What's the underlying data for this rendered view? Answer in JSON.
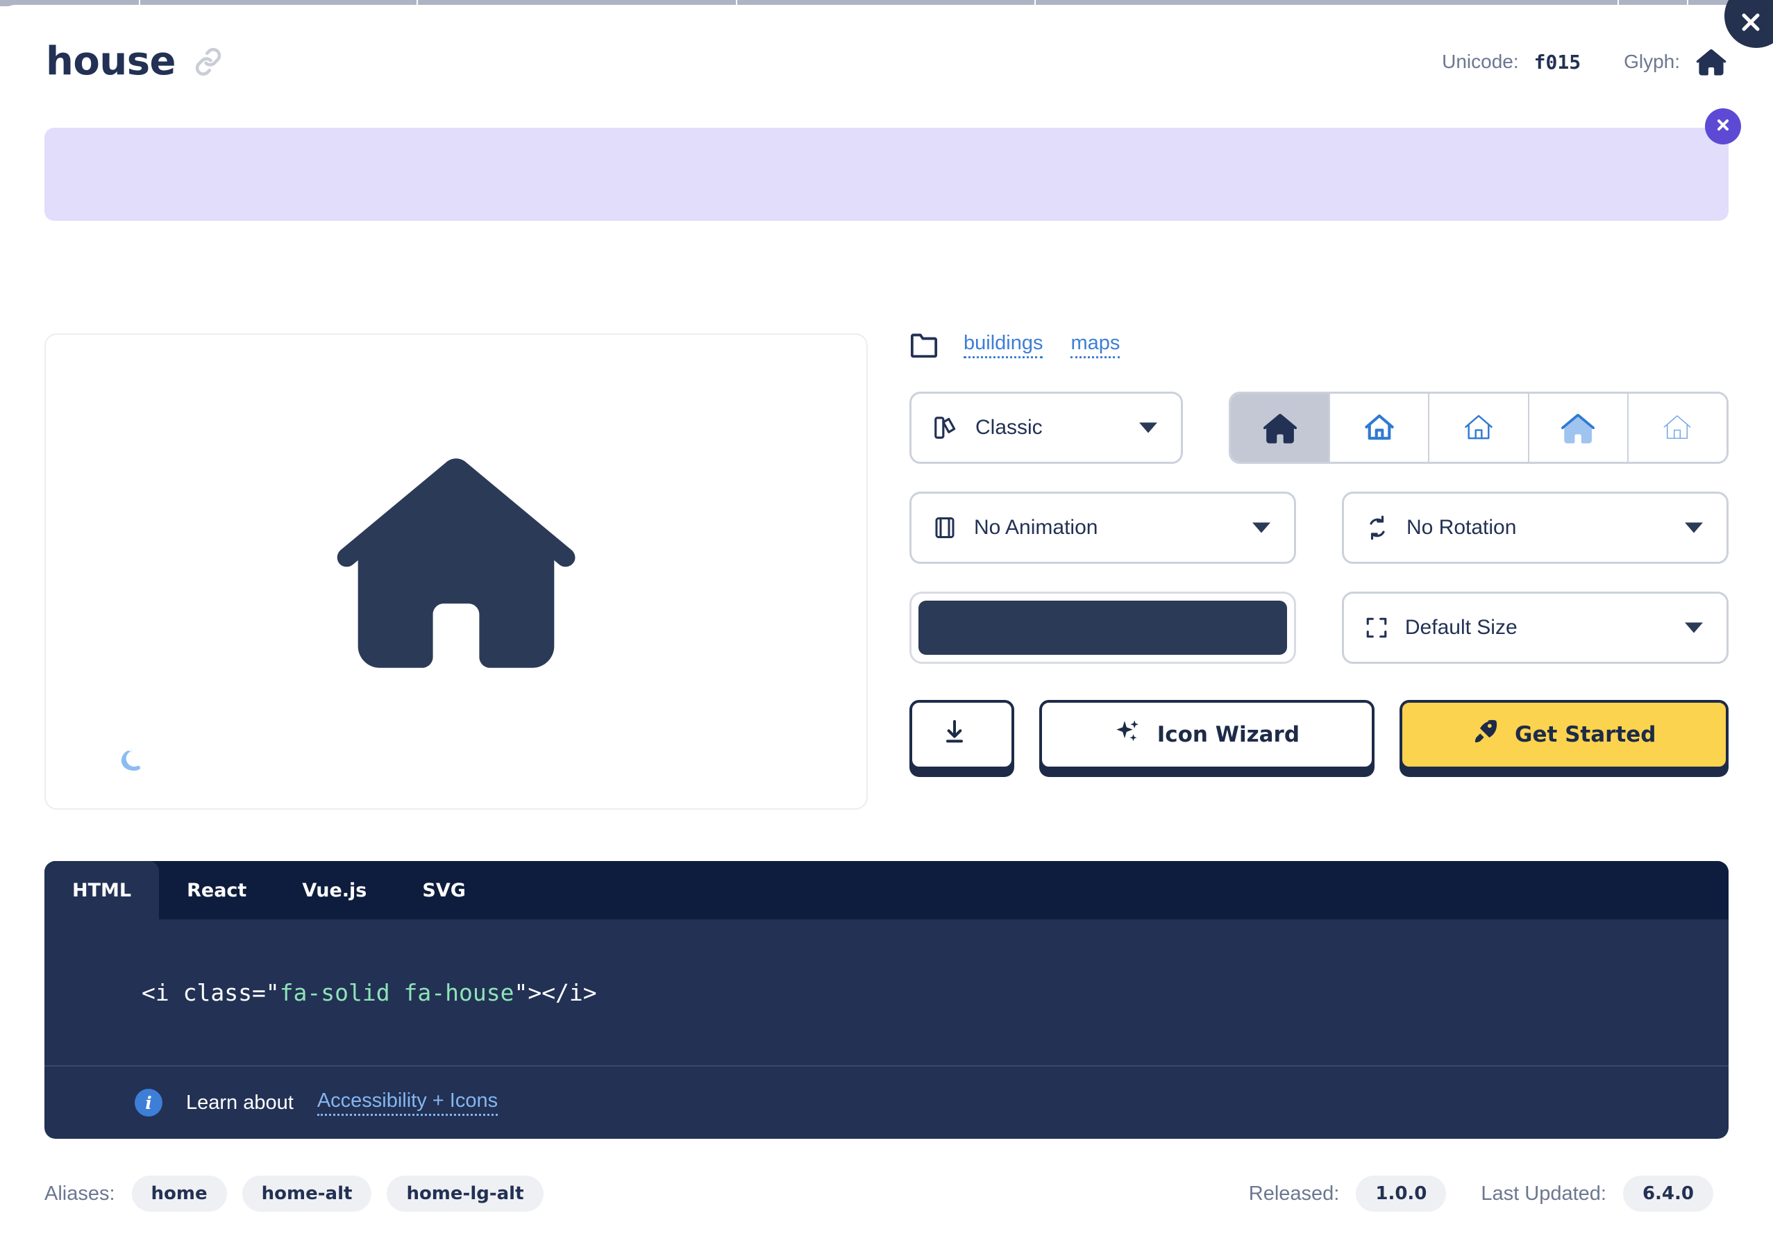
{
  "header": {
    "icon_name": "house",
    "link_icon": "link-icon",
    "unicode_label": "Unicode:",
    "unicode_value": "f015",
    "glyph_label": "Glyph:",
    "glyph_icon": "house-glyph-icon"
  },
  "promo": {
    "close_label": "×",
    "close_icon": "close-icon"
  },
  "top_bar": {
    "close_icon": "close-icon"
  },
  "preview": {
    "glyph_icon": "house-icon",
    "dark_mode_icon": "moon-icon",
    "glyph_color": "#2b3a57"
  },
  "categories": {
    "folder_icon": "folder-icon",
    "links": [
      {
        "label": "buildings"
      },
      {
        "label": "maps"
      }
    ]
  },
  "controls": {
    "style": {
      "icon": "palette-icon",
      "value": "Classic",
      "caret_icon": "chevron-down-icon"
    },
    "animation": {
      "icon": "film-icon",
      "value": "No Animation",
      "caret_icon": "chevron-down-icon"
    },
    "rotation": {
      "icon": "rotate-icon",
      "value": "No Rotation",
      "caret_icon": "chevron-down-icon"
    },
    "size": {
      "icon": "expand-icon",
      "value": "Default Size",
      "caret_icon": "chevron-down-icon"
    },
    "color": {
      "swatch_value": "#2b3a57"
    },
    "variants": [
      {
        "name": "solid",
        "icon": "house-solid-icon",
        "active": true
      },
      {
        "name": "regular",
        "icon": "house-regular-icon",
        "active": false
      },
      {
        "name": "light",
        "icon": "house-light-icon",
        "active": false
      },
      {
        "name": "duotone",
        "icon": "house-duotone-icon",
        "active": false
      },
      {
        "name": "thin",
        "icon": "house-thin-icon",
        "active": false
      }
    ]
  },
  "actions": {
    "download": {
      "label": "",
      "icon": "download-icon"
    },
    "wizard": {
      "label": "Icon Wizard",
      "icon": "sparkles-icon"
    },
    "start": {
      "label": "Get Started",
      "icon": "rocket-icon",
      "color": "#fcd34f"
    }
  },
  "code": {
    "tabs": [
      {
        "label": "HTML",
        "active": true
      },
      {
        "label": "React",
        "active": false
      },
      {
        "label": "Vue.js",
        "active": false
      },
      {
        "label": "SVG",
        "active": false
      }
    ],
    "snippet_prefix": "<i class=\"",
    "snippet_attr": "fa-solid fa-house",
    "snippet_suffix": "\"></i>",
    "footer_info_icon": "info-icon",
    "footer_text": "Learn about",
    "footer_link": "Accessibility + Icons"
  },
  "footer": {
    "aliases_label": "Aliases:",
    "aliases": [
      "home",
      "home-alt",
      "home-lg-alt"
    ],
    "released_label": "Released:",
    "released_value": "1.0.0",
    "updated_label": "Last Updated:",
    "updated_value": "6.4.0"
  }
}
